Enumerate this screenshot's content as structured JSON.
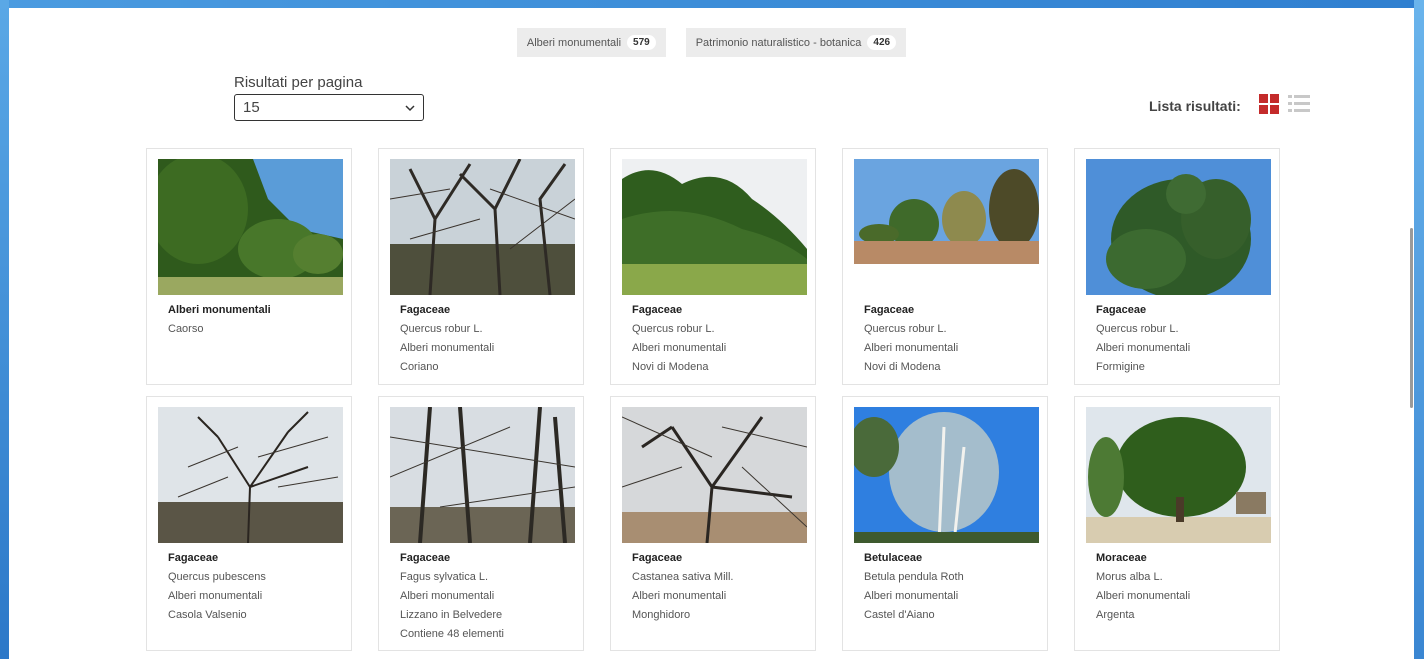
{
  "facets": [
    {
      "label": "Alberi monumentali",
      "count": "579"
    },
    {
      "label": "Patrimonio naturalistico - botanica",
      "count": "426"
    }
  ],
  "per_page": {
    "label": "Risultati per pagina",
    "value": "15"
  },
  "list_label": "Lista risultati:",
  "icons": {
    "grid": "grid-view-icon",
    "list": "list-view-icon",
    "select": "chevron-down-icon"
  },
  "colors": {
    "accent": "#c42b2b",
    "frame": "#3a8ad6"
  },
  "results": [
    {
      "lines": [
        "Alberi monumentali",
        "Caorso"
      ]
    },
    {
      "lines": [
        "Fagaceae",
        "Quercus robur L.",
        "Alberi monumentali",
        "Coriano"
      ]
    },
    {
      "lines": [
        "Fagaceae",
        "Quercus robur L.",
        "Alberi monumentali",
        "Novi di Modena"
      ]
    },
    {
      "lines": [
        "Fagaceae",
        "Quercus robur L.",
        "Alberi monumentali",
        "Novi di Modena"
      ]
    },
    {
      "lines": [
        "Fagaceae",
        "Quercus robur L.",
        "Alberi monumentali",
        "Formigine"
      ]
    },
    {
      "lines": [
        "Fagaceae",
        "Quercus pubescens",
        "Alberi monumentali",
        "Casola Valsenio"
      ]
    },
    {
      "lines": [
        "Fagaceae",
        "Fagus sylvatica L.",
        "Alberi monumentali",
        "Lizzano in Belvedere",
        "Contiene 48 elementi"
      ]
    },
    {
      "lines": [
        "Fagaceae",
        "Castanea sativa Mill.",
        "Alberi monumentali",
        "Monghidoro"
      ]
    },
    {
      "lines": [
        "Betulaceae",
        "Betula pendula Roth",
        "Alberi monumentali",
        "Castel d'Aiano"
      ]
    },
    {
      "lines": [
        "Moraceae",
        "Morus alba L.",
        "Alberi monumentali",
        "Argenta"
      ]
    }
  ]
}
